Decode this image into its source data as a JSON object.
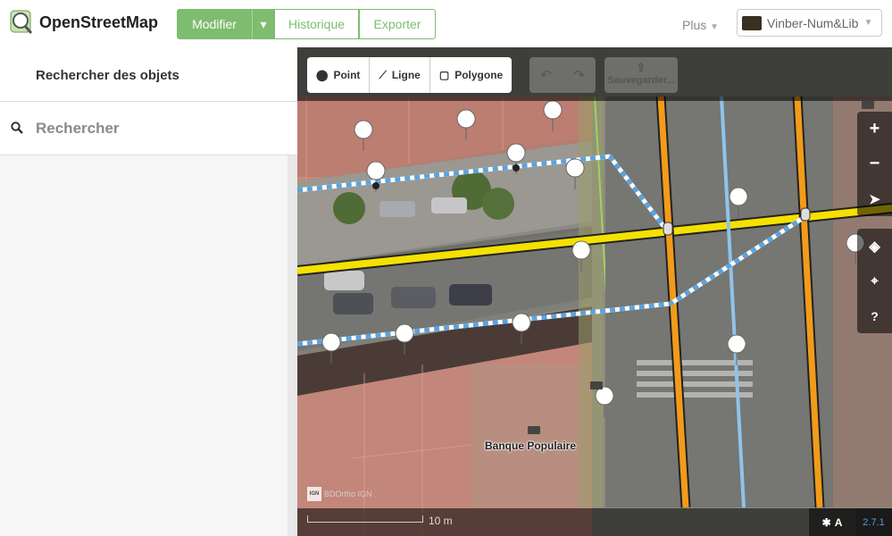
{
  "brand": {
    "name": "OpenStreetMap"
  },
  "nav": {
    "modifier": "Modifier",
    "historique": "Historique",
    "exporter": "Exporter",
    "plus": "Plus",
    "user": "Vinber-Num&Lib"
  },
  "sidebar": {
    "title": "Rechercher des objets",
    "search_placeholder": "Rechercher"
  },
  "map_toolbar": {
    "point": "Point",
    "ligne": "Ligne",
    "polygone": "Polygone",
    "save": "Sauvegarder..."
  },
  "map": {
    "label_bank": "Banque Populaire",
    "attribution": "BDOrtho IGN",
    "ign": "IGN",
    "scale": "10 m",
    "version": "2.7.1"
  },
  "colors": {
    "brand_green": "#7ebc6f",
    "road_yellow": "#f5e100",
    "road_orange": "#f29b1a",
    "path_blue": "#8fc3ea"
  }
}
